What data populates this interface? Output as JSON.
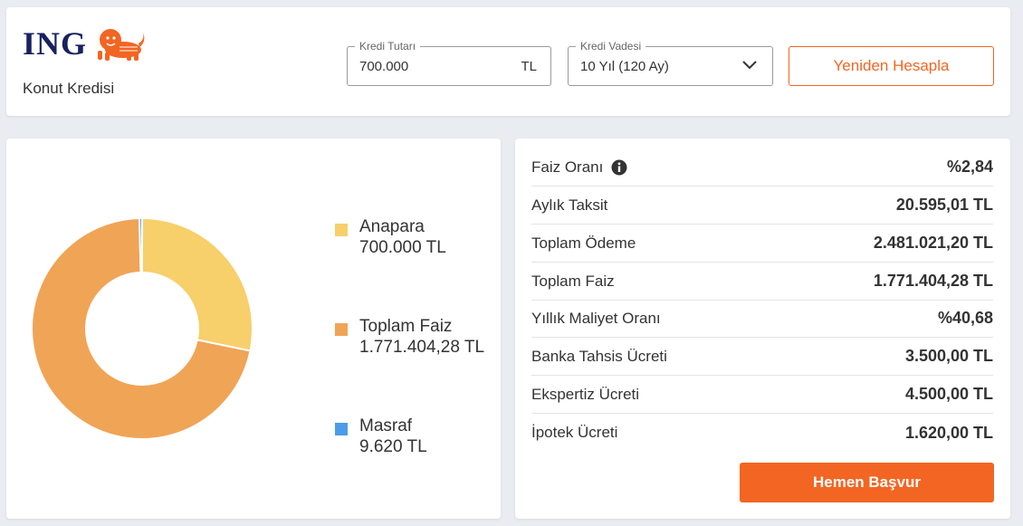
{
  "brand": {
    "logo_text": "ING",
    "logo_icon": "lion-icon",
    "product": "Konut Kredisi",
    "accent_color": "#f26522",
    "navy_color": "#17225f"
  },
  "form": {
    "amount_label": "Kredi Tutarı",
    "amount_value": "700.000",
    "amount_suffix": "TL",
    "term_label": "Kredi Vadesi",
    "term_value": "10 Yıl (120 Ay)",
    "recalc_label": "Yeniden Hesapla"
  },
  "chart_data": {
    "type": "pie",
    "style": "donut",
    "legend_position": "right",
    "series": [
      {
        "name": "Anapara",
        "value": 700000,
        "value_label": "700.000 TL",
        "color": "#f7cf6b"
      },
      {
        "name": "Toplam Faiz",
        "value": 1771404.28,
        "value_label": "1.771.404,28 TL",
        "color": "#f0a456"
      },
      {
        "name": "Masraf",
        "value": 9620,
        "value_label": "9.620 TL",
        "color": "#4c9be8"
      }
    ]
  },
  "details": {
    "rows": [
      {
        "label": "Faiz Oranı",
        "value": "%2,84",
        "info_icon": "info-icon"
      },
      {
        "label": "Aylık Taksit",
        "value": "20.595,01 TL"
      },
      {
        "label": "Toplam Ödeme",
        "value": "2.481.021,20 TL"
      },
      {
        "label": "Toplam Faiz",
        "value": "1.771.404,28 TL"
      },
      {
        "label": "Yıllık Maliyet Oranı",
        "value": "%40,68"
      },
      {
        "label": "Banka Tahsis Ücreti",
        "value": "3.500,00 TL"
      },
      {
        "label": "Ekspertiz Ücreti",
        "value": "4.500,00 TL"
      },
      {
        "label": "İpotek Ücreti",
        "value": "1.620,00 TL"
      }
    ],
    "apply_label": "Hemen Başvur"
  }
}
